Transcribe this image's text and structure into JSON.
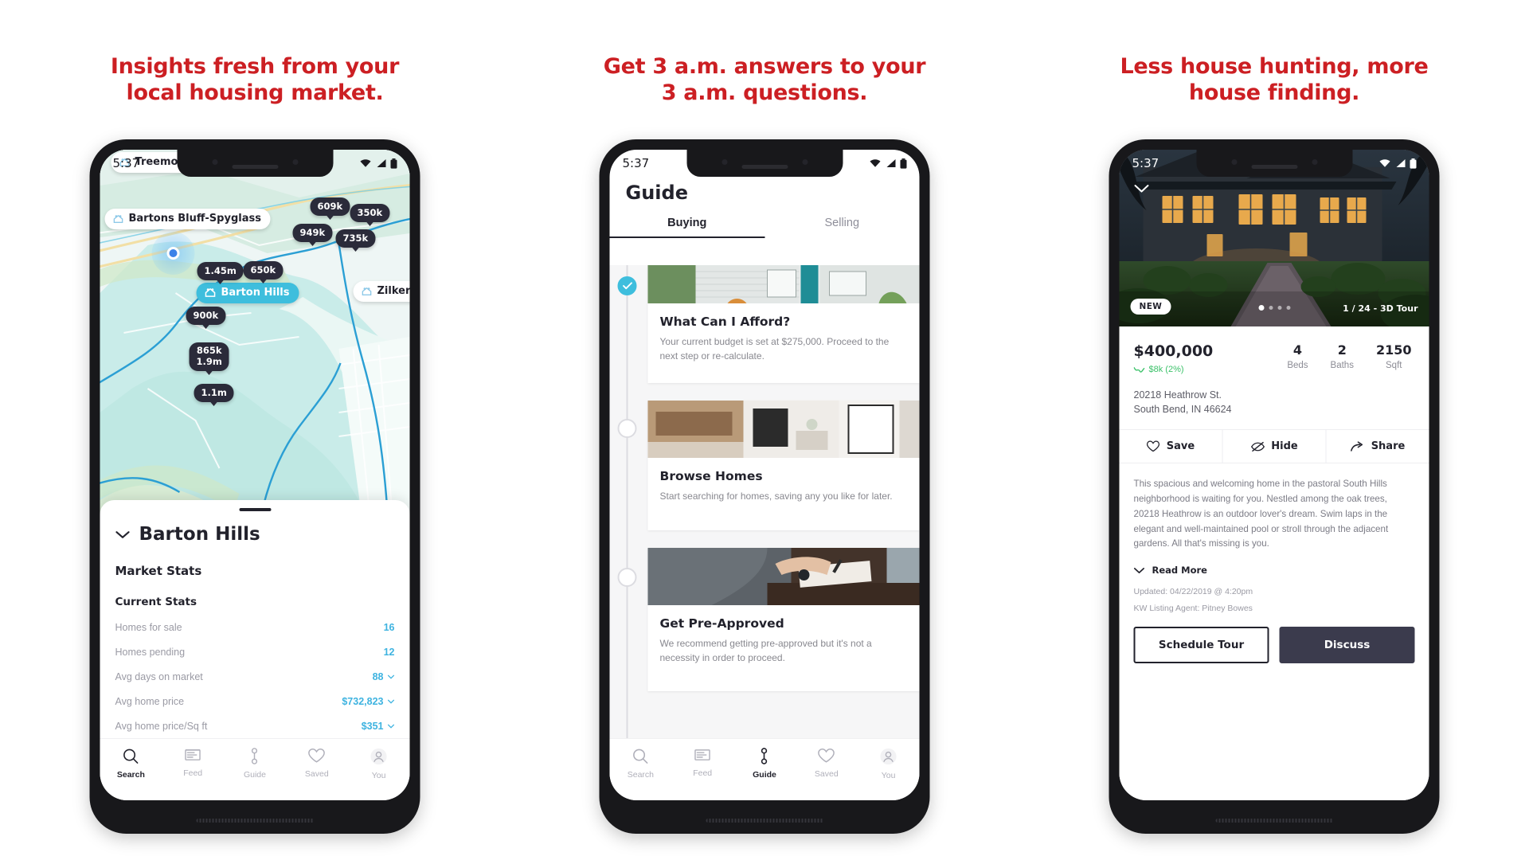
{
  "panels": [
    {
      "headline": "Insights fresh from your local housing market.",
      "status_time": "5:37",
      "map": {
        "neighborhood_labels": [
          {
            "name": "Treemont",
            "active": false
          },
          {
            "name": "Bartons Bluff-Spyglass",
            "active": false
          },
          {
            "name": "Barton Hills",
            "active": true
          },
          {
            "name": "Zilker W",
            "active": false
          }
        ],
        "price_pins": [
          "609k",
          "350k",
          "949k",
          "735k",
          "1.45m",
          "650k",
          "900k",
          "865k",
          "1.9m",
          "1.1m"
        ]
      },
      "sheet": {
        "title": "Barton Hills",
        "section_heading": "Market Stats",
        "subsection_heading": "Current Stats",
        "stats": [
          {
            "label": "Homes for sale",
            "value": "16",
            "chevron": false
          },
          {
            "label": "Homes pending",
            "value": "12",
            "chevron": false
          },
          {
            "label": "Avg days on market",
            "value": "88",
            "chevron": true
          },
          {
            "label": "Avg home price",
            "value": "$732,823",
            "chevron": true
          },
          {
            "label": "Avg home price/Sq ft",
            "value": "$351",
            "chevron": true
          }
        ]
      },
      "tabbar": [
        {
          "label": "Search",
          "icon": "search-icon",
          "active": true
        },
        {
          "label": "Feed",
          "icon": "feed-icon",
          "active": false
        },
        {
          "label": "Guide",
          "icon": "guide-icon",
          "active": false
        },
        {
          "label": "Saved",
          "icon": "heart-icon",
          "active": false
        },
        {
          "label": "You",
          "icon": "person-icon",
          "active": false
        }
      ]
    },
    {
      "headline": "Get 3 a.m. answers to your 3 a.m. questions.",
      "status_time": "5:37",
      "title": "Guide",
      "tabs": [
        {
          "label": "Buying",
          "active": true
        },
        {
          "label": "Selling",
          "active": false
        }
      ],
      "cards": [
        {
          "title": "What Can I Afford?",
          "body": "Your current budget is set at $275,000. Proceed to the next step or re-calculate.",
          "state": "done"
        },
        {
          "title": "Browse Homes",
          "body": "Start searching for homes, saving any you like for later.",
          "state": "pending"
        },
        {
          "title": "Get Pre-Approved",
          "body": "We recommend getting pre-approved but it's not a necessity in order to proceed.",
          "state": "pending"
        }
      ],
      "tabbar": [
        {
          "label": "Search",
          "icon": "search-icon",
          "active": false
        },
        {
          "label": "Feed",
          "icon": "feed-icon",
          "active": false
        },
        {
          "label": "Guide",
          "icon": "guide-icon",
          "active": true
        },
        {
          "label": "Saved",
          "icon": "heart-icon",
          "active": false
        },
        {
          "label": "You",
          "icon": "person-icon",
          "active": false
        }
      ]
    },
    {
      "headline": "Less house hunting, more house finding.",
      "status_time": "5:37",
      "hero": {
        "badge": "NEW",
        "counter": "1 / 24  -  3D Tour"
      },
      "listing": {
        "price": "$400,000",
        "price_delta": "$8k (2%)",
        "facts": [
          {
            "value": "4",
            "label": "Beds"
          },
          {
            "value": "2",
            "label": "Baths"
          },
          {
            "value": "2150",
            "label": "Sqft"
          }
        ],
        "address_line1": "20218 Heathrow St.",
        "address_line2": "South Bend, IN 46624",
        "actions": [
          {
            "label": "Save",
            "icon": "heart-icon"
          },
          {
            "label": "Hide",
            "icon": "eye-off-icon"
          },
          {
            "label": "Share",
            "icon": "share-icon"
          }
        ],
        "description": "This spacious and welcoming home in the pastoral South Hills neighborhood is waiting for you. Nestled among the oak trees, 20218 Heathrow is an outdoor lover's dream. Swim laps in the elegant and well-maintained pool or stroll through the adjacent gardens. All that's missing is you.",
        "read_more": "Read More",
        "updated": "Updated: 04/22/2019 @ 4:20pm",
        "agent": "KW Listing Agent: Pitney Bowes",
        "cta_secondary": "Schedule Tour",
        "cta_primary": "Discuss"
      }
    }
  ],
  "colors": {
    "headline_red": "#cc1f23",
    "accent_blue": "#3eb3e0",
    "teal": "#3ebedd",
    "dark": "#22222c",
    "green": "#3cc26a",
    "discuss_navy": "#3b3b4d"
  }
}
